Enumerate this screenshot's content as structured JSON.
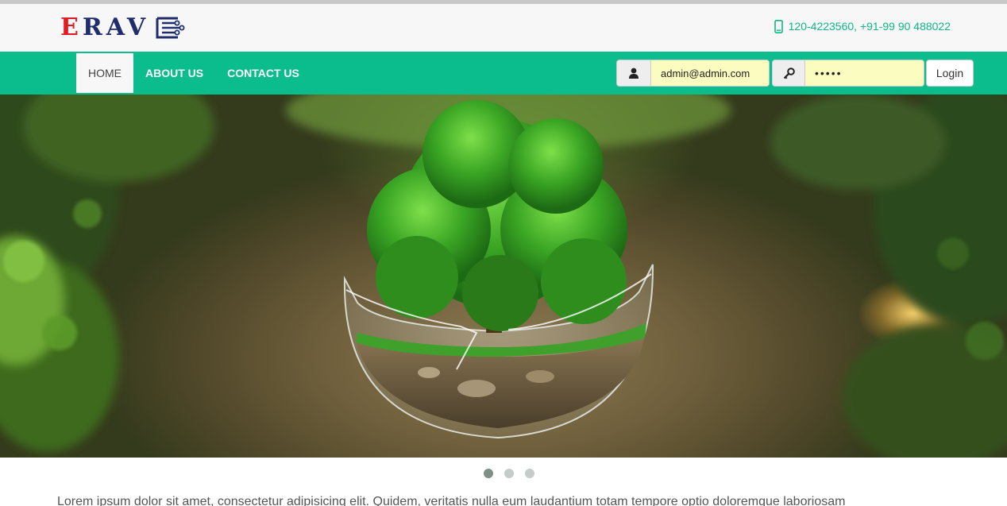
{
  "header": {
    "logo": {
      "first_letter": "E",
      "rest": "RAV",
      "icon": "circuit-e-icon"
    },
    "contact": {
      "icon": "mobile-phone-icon",
      "phones": "120-4223560, +91-99 90 488022"
    }
  },
  "nav": {
    "items": [
      {
        "label": "HOME",
        "active": true
      },
      {
        "label": "ABOUT US",
        "active": false
      },
      {
        "label": "CONTACT US",
        "active": false
      }
    ]
  },
  "login": {
    "user_icon": "user-icon",
    "email_value": "admin@admin.com",
    "key_icon": "key-icon",
    "password_value": "•••••",
    "button_label": "Login"
  },
  "hero": {
    "image": "tree-in-glass-sphere",
    "carousel_active_index": 0,
    "carousel_count": 3
  },
  "content": {
    "intro": "Lorem ipsum dolor sit amet, consectetur adipisicing elit. Quidem, veritatis nulla eum laudantium totam tempore optio doloremque laboriosam"
  },
  "colors": {
    "brand_green": "#0bbc8c",
    "logo_red": "#e21b23",
    "logo_navy": "#1f2d6c",
    "input_highlight": "#fbfcc0"
  }
}
